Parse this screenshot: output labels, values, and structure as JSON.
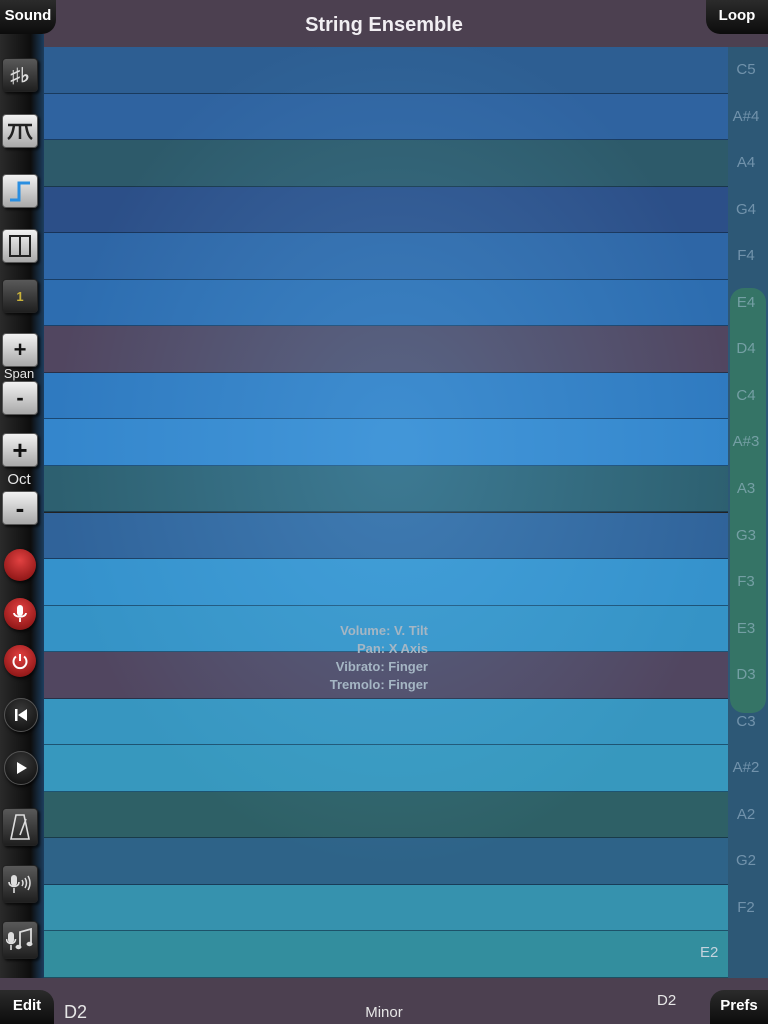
{
  "header": {
    "title": "String Ensemble",
    "sound_label": "Sound",
    "loop_label": "Loop"
  },
  "footer": {
    "edit_label": "Edit",
    "prefs_label": "Prefs",
    "root_left": "D2",
    "root_right": "D2",
    "scale": "Minor"
  },
  "toolbar": {
    "accidentals": "♯♭",
    "count": "1",
    "plus": "+",
    "minus": "-",
    "span_label": "Span",
    "oct_label": "Oct"
  },
  "notes": [
    "C5",
    "A#4",
    "A4",
    "G4",
    "F4",
    "E4",
    "D4",
    "C4",
    "A#3",
    "A3",
    "G3",
    "F3",
    "E3",
    "D3",
    "C3",
    "A#2",
    "A2",
    "G2",
    "F2",
    "E2"
  ],
  "lowest_note_label": "E2",
  "row_colors": [
    "#2d5e92",
    "#2f63a0",
    "#2d5a6a",
    "#2c4f88",
    "#2e66a6",
    "#2d6db0",
    "#514660",
    "#2f7ac0",
    "#3486cc",
    "#2d6070",
    "#30639a",
    "#3592cc",
    "#3593c6",
    "#514660",
    "#3796c0",
    "#3798be",
    "#2e6066",
    "#2e6388",
    "#3692ae",
    "#338e9e"
  ],
  "hud": {
    "volume": "Volume: V. Tilt",
    "pan": "Pan: X Axis",
    "vibrato": "Vibrato: Finger",
    "tremolo": "Tremolo: Finger"
  },
  "colors": {
    "bar": "#4c4050",
    "highlight": "#3c8c5a"
  }
}
